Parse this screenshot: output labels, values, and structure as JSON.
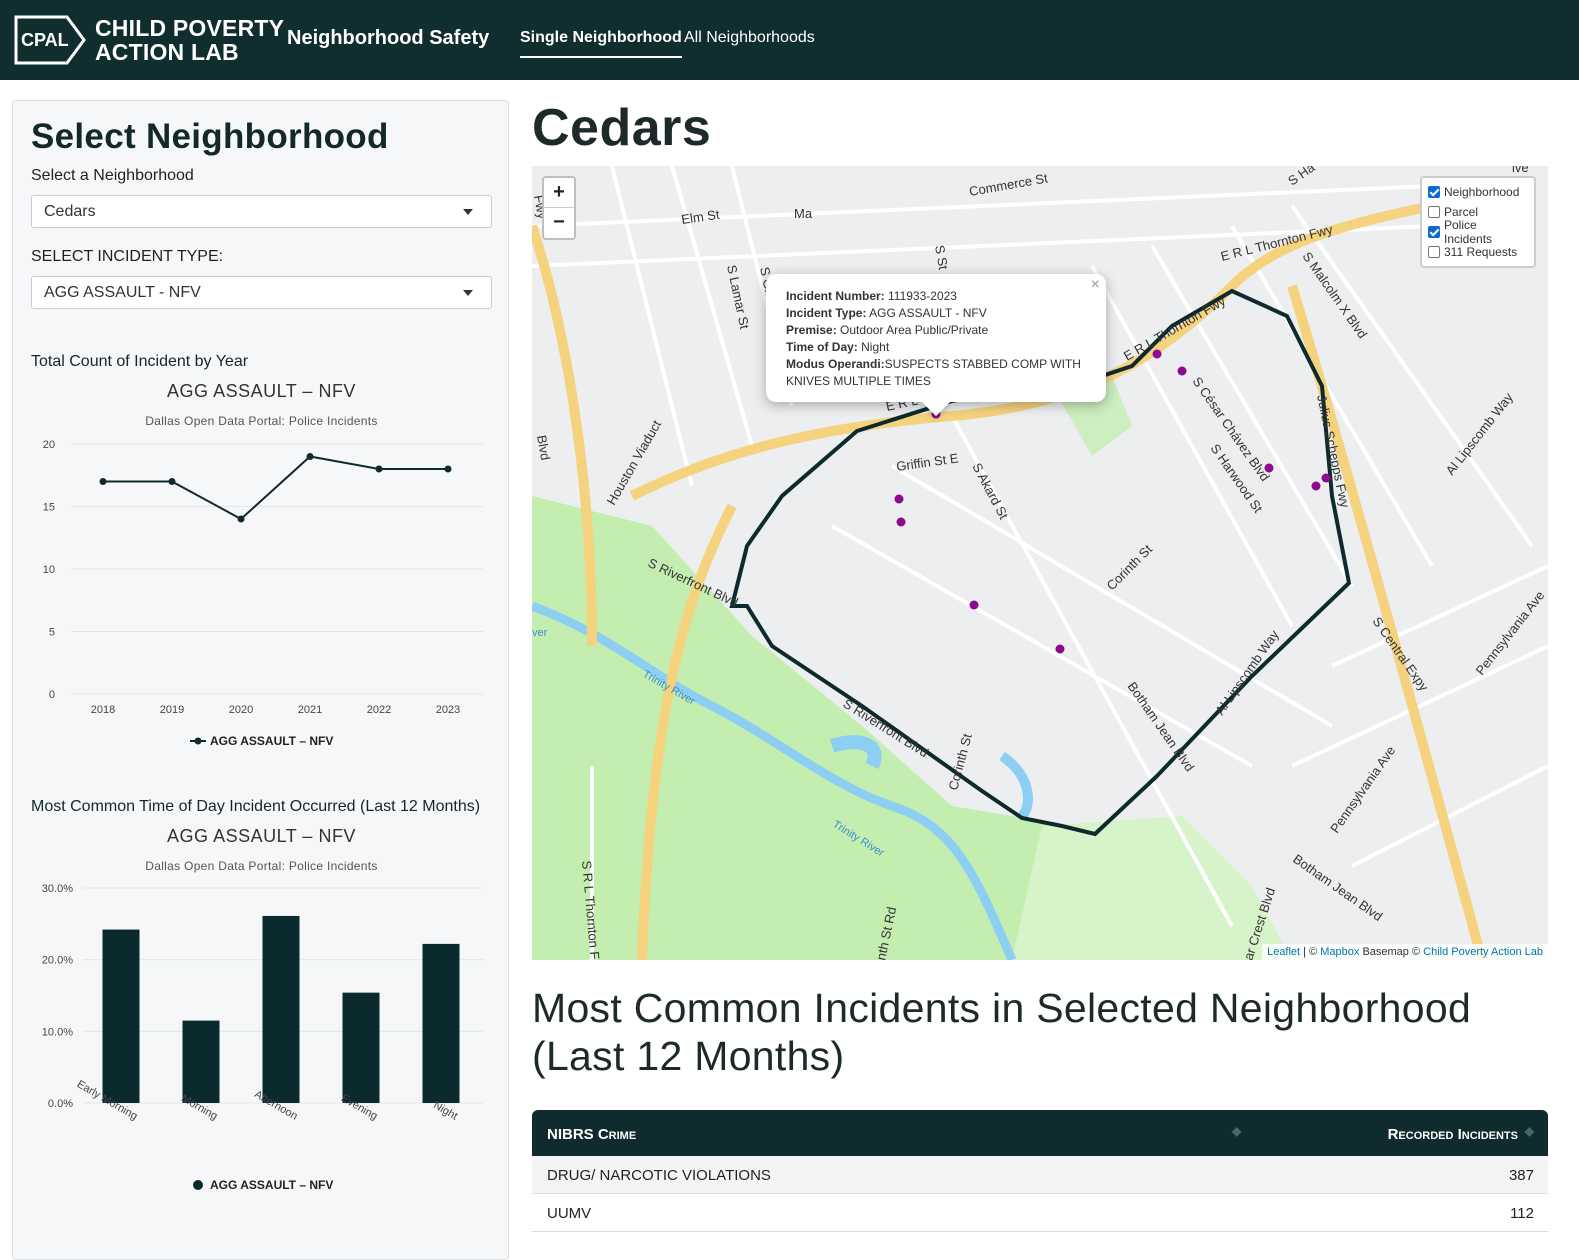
{
  "brand": {
    "logo_text": "CPAL",
    "name_line1": "CHILD POVERTY",
    "name_line2": "ACTION LAB",
    "app_title": "Neighborhood Safety"
  },
  "nav": {
    "tab_single": "Single Neighborhood",
    "tab_all": "All Neighborhoods"
  },
  "sidebar": {
    "title": "Select Neighborhood",
    "neighborhood_label": "Select a Neighborhood",
    "neighborhood_value": "Cedars",
    "incident_label": "SELECT INCIDENT TYPE:",
    "incident_value": "AGG ASSAULT - NFV"
  },
  "chart_data": [
    {
      "type": "line",
      "heading": "Total Count of Incident by Year",
      "title": "AGG ASSAULT – NFV",
      "subtitle": "Dallas Open Data Portal: Police Incidents",
      "categories": [
        "2018",
        "2019",
        "2020",
        "2021",
        "2022",
        "2023"
      ],
      "series": [
        {
          "name": "AGG ASSAULT – NFV",
          "values": [
            17,
            17,
            14,
            19,
            18,
            18
          ]
        }
      ],
      "yticks": [
        "0",
        "5",
        "10",
        "15",
        "20"
      ],
      "ylim": [
        0,
        20
      ],
      "grid": true,
      "legend": "bottom"
    },
    {
      "type": "bar",
      "heading": "Most Common Time of Day Incident Occurred (Last 12 Months)",
      "title": "AGG ASSAULT – NFV",
      "subtitle": "Dallas Open Data Portal: Police Incidents",
      "categories": [
        "Early Morning",
        "Morning",
        "Afternoon",
        "Evening",
        "Night"
      ],
      "series": [
        {
          "name": "AGG ASSAULT – NFV",
          "values": [
            24.2,
            11.5,
            26.1,
            15.4,
            22.2
          ]
        }
      ],
      "yticks": [
        "0.0%",
        "10.0%",
        "20.0%",
        "30.0%"
      ],
      "ylim": [
        0,
        30
      ],
      "grid": true,
      "legend": "bottom"
    }
  ],
  "main": {
    "neighborhood_title": "Cedars",
    "section_title": "Most Common Incidents in Selected Neighborhood (Last 12 Months)"
  },
  "map": {
    "zoom_in": "+",
    "zoom_out": "−",
    "layers": [
      {
        "label": "Neighborhood",
        "checked": true
      },
      {
        "label": "Parcel",
        "checked": false
      },
      {
        "label": "Police Incidents",
        "checked": true
      },
      {
        "label": "311 Requests",
        "checked": false
      }
    ],
    "popup": {
      "incident_number_label": "Incident Number:",
      "incident_number": "111933-2023",
      "incident_type_label": "Incident Type:",
      "incident_type": "AGG ASSAULT - NFV",
      "premise_label": "Premise:",
      "premise": "Outdoor Area Public/Private",
      "time_label": "Time of Day:",
      "time": "Night",
      "mo_label": "Modus Operandi:",
      "mo": "SUSPECTS STABBED COMP WITH KNIVES MULTIPLE TIMES",
      "close": "×"
    },
    "attribution": {
      "leaflet": "Leaflet",
      "sep": " | © ",
      "mapbox": "Mapbox",
      "basemap": " Basemap © ",
      "cpal": "Child Poverty Action Lab"
    },
    "labels": [
      "Commerce St",
      "Elm St",
      "Ma",
      "E R L Thornton Fwy",
      "S Malcolm X Blvd",
      "S Lamar St",
      "S Griffin",
      "S St",
      "E R L Thornton Fwy",
      "S César Chávez Blvd",
      "S Harwood St",
      "Julius Schepps Fwy",
      "Al Lipscomb Way",
      "Houston Viaduct",
      "E R L",
      "Griffin St E",
      "S Akard St",
      "Corinth St",
      "S Riverfront Blvd",
      "Trinity River",
      "S Riverfront Blvd",
      "Botham Jean Blvd",
      "Al Lipscomb Way",
      "S Central Expy",
      "Pennsylvania Ave",
      "Pennsylvania Ave",
      "Corinth St",
      "Trinity River",
      "Botham Jean Blvd",
      "S R L Thornton F",
      "nth St Rd",
      "ar Crest Blvd",
      "Blvd",
      "S Ha",
      "ive",
      "Fwy",
      "ver"
    ],
    "accent": "#8b0a8f",
    "boundary_color": "#0d2b2d"
  },
  "table": {
    "headers": [
      "NIBRS Crime",
      "Recorded Incidents"
    ],
    "rows": [
      [
        "DRUG/ NARCOTIC VIOLATIONS",
        "387"
      ],
      [
        "UUMV",
        "112"
      ]
    ]
  }
}
